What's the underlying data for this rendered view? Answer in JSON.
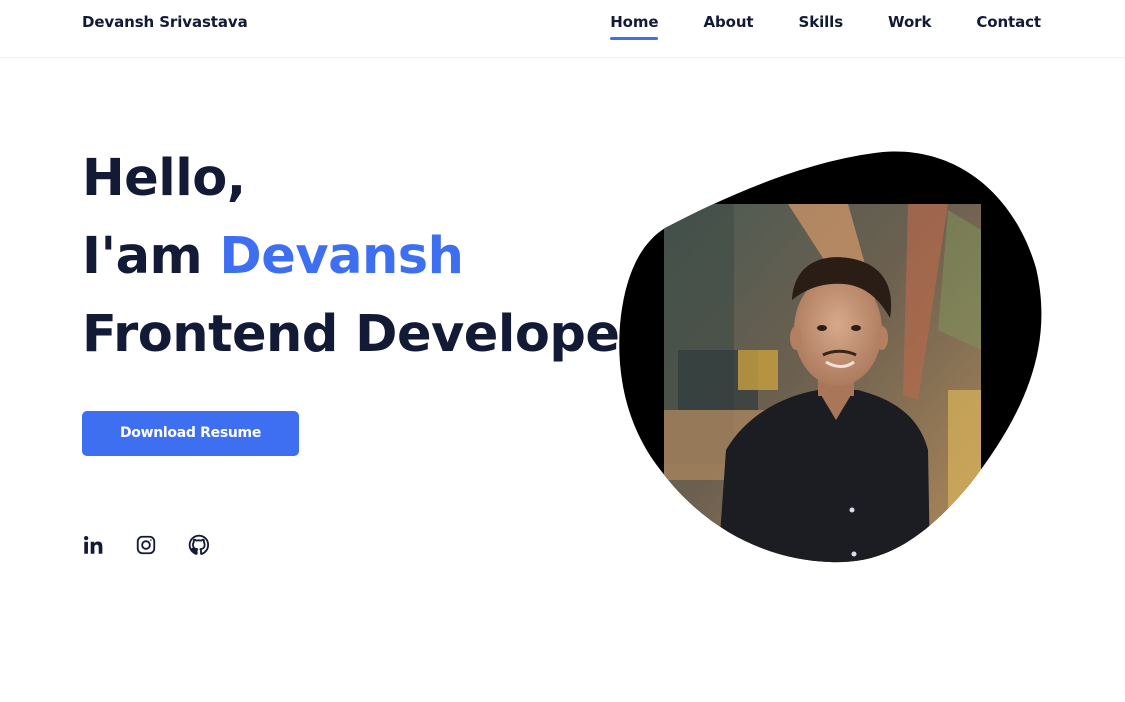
{
  "header": {
    "logo": "Devansh Srivastava",
    "nav": [
      {
        "label": "Home",
        "active": true
      },
      {
        "label": "About",
        "active": false
      },
      {
        "label": "Skills",
        "active": false
      },
      {
        "label": "Work",
        "active": false
      },
      {
        "label": "Contact",
        "active": false
      }
    ]
  },
  "hero": {
    "greeting": "Hello,",
    "intro_prefix": "I'am ",
    "name": "Devansh",
    "role": "Frontend Developer",
    "button_label": "Download Resume"
  },
  "socials": [
    {
      "icon": "linkedin-icon"
    },
    {
      "icon": "instagram-icon"
    },
    {
      "icon": "github-icon"
    }
  ],
  "colors": {
    "accent": "#3f6ff1",
    "text": "#121a36",
    "blob": "#000000"
  }
}
